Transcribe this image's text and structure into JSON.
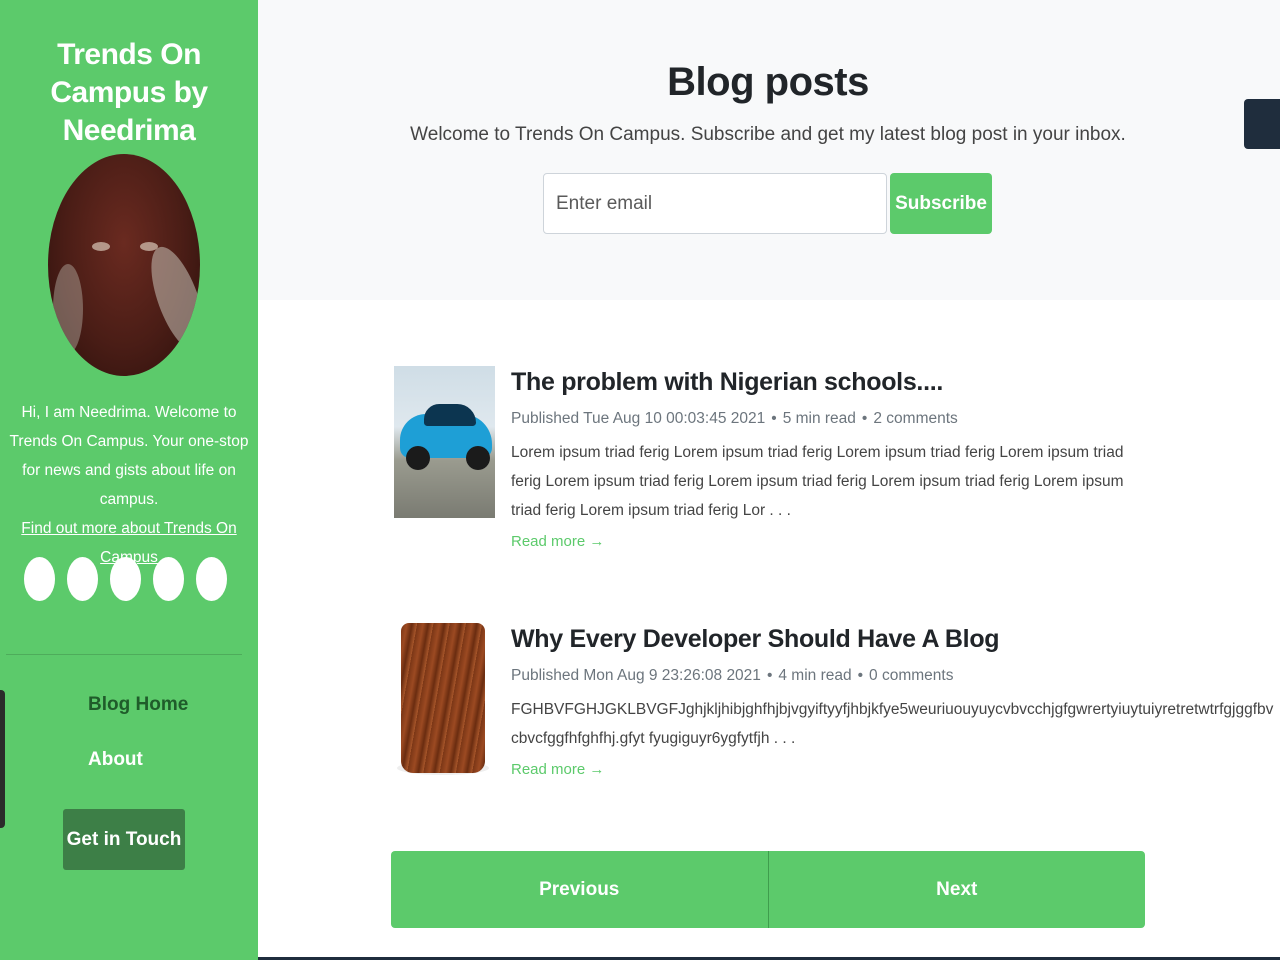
{
  "sidebar": {
    "site_title": "Trends On Campus by Needrima",
    "bio": "Hi, I am Needrima. Welcome to Trends On Campus. Your one-stop for news and gists about life on campus.",
    "bio_link": "Find out more about Trends On Campus",
    "nav": {
      "home": "Blog Home",
      "about": "About"
    },
    "cta": "Get in Touch"
  },
  "header": {
    "title": "Blog posts",
    "subtitle": "Welcome to Trends On Campus. Subscribe and get my latest blog post in your inbox.",
    "email_placeholder": "Enter email",
    "subscribe_label": "Subscribe"
  },
  "posts": [
    {
      "title": "The problem with Nigerian schools....",
      "published": "Published Tue Aug 10 00:03:45 2021",
      "read_time": "5 min read",
      "comments": "2 comments",
      "excerpt": "Lorem ipsum triad ferig Lorem ipsum triad ferig Lorem ipsum triad ferig Lorem ipsum triad ferig Lorem ipsum triad ferig Lorem ipsum triad ferig Lorem ipsum triad ferig Lorem ipsum triad ferig Lorem ipsum triad ferig Lor . . .",
      "read_more": "Read more →"
    },
    {
      "title": "Why Every Developer Should Have A Blog",
      "published": "Published Mon Aug 9 23:26:08 2021",
      "read_time": "4 min read",
      "comments": "0 comments",
      "excerpt": "FGHBVFGHJGKLBVGFJghjkljhibjghfhjbjvgyiftyyfjhbjkfye5weuriuouyuycvbvcchjgfgwrertyiuytuiyretretwtrfgjggfbvcbvcfggfhfghfhj.gfyt fyugiguyr6ygfytfjh . . .",
      "read_more": "Read more →"
    }
  ],
  "pager": {
    "previous": "Previous",
    "next": "Next"
  },
  "colors": {
    "brand_green": "#5cca6b",
    "dark_green": "#3d7f47",
    "nav_active": "#1f5c2a"
  }
}
